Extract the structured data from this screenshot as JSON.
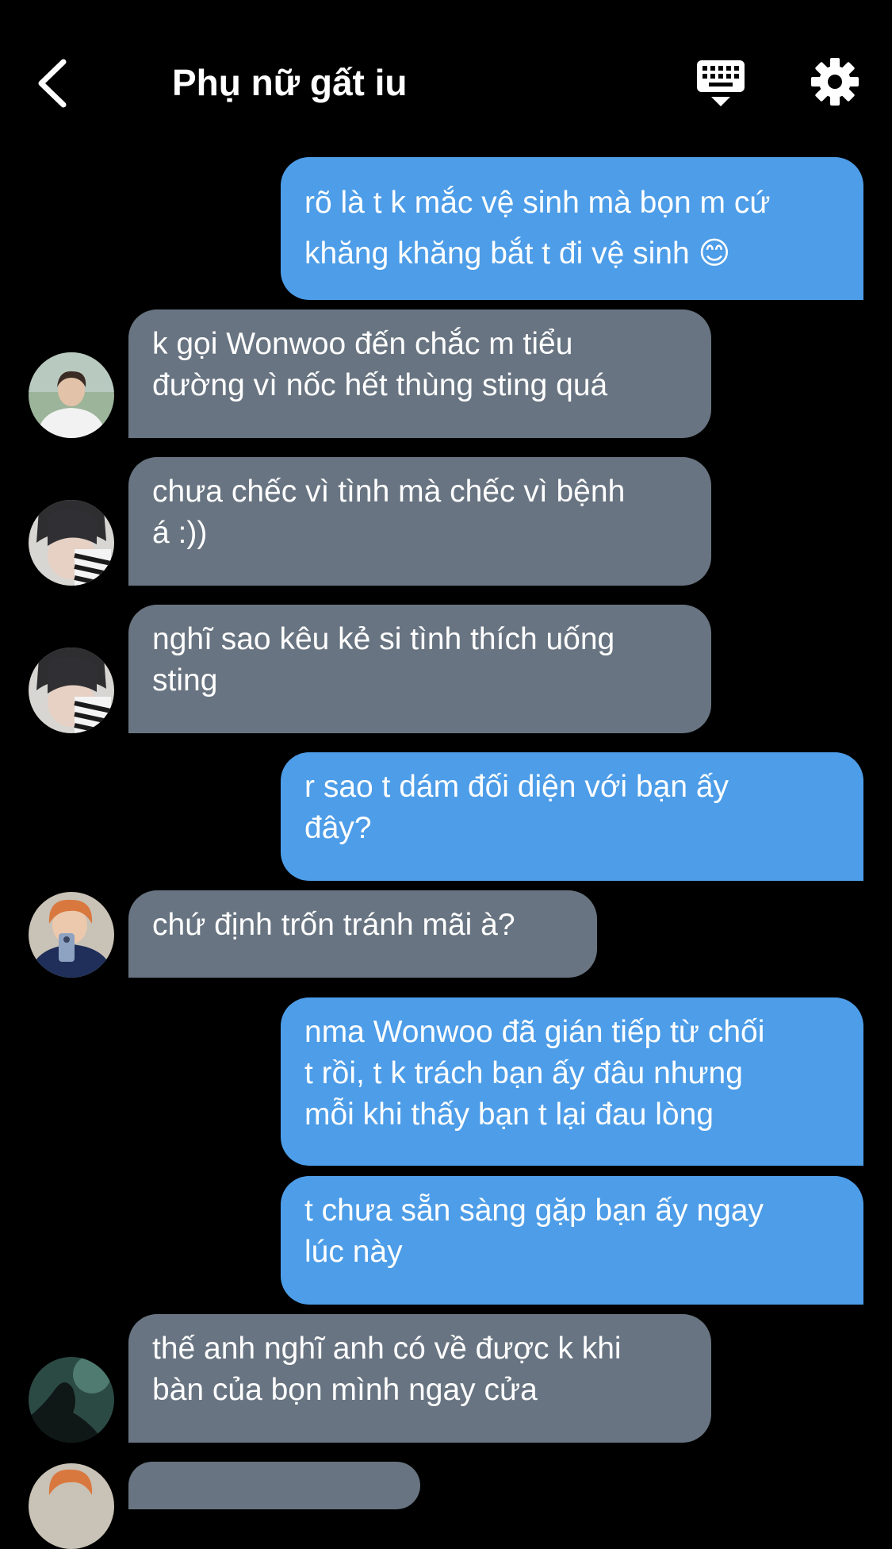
{
  "header": {
    "title": "Phụ nữ gất iu",
    "back_icon": "chevron-left-icon",
    "keyboard_icon": "keyboard-icon",
    "settings_icon": "gear-icon"
  },
  "colors": {
    "background": "#000000",
    "outgoing_bubble": "#4d9de8",
    "incoming_bubble": "#687481",
    "text": "#ffffff"
  },
  "messages": [
    {
      "direction": "out",
      "text": "rõ là t k mắc vệ sinh mà bọn m cứ\nkhăng khăng bắt t đi vệ sinh 😊"
    },
    {
      "direction": "in",
      "avatar": "avatar-boy-white-shirt",
      "text": "k gọi Wonwoo đến chắc m tiểu\nđường vì nốc hết thùng sting quá"
    },
    {
      "direction": "in",
      "avatar": "avatar-boy-striped-mask",
      "text": "chưa chếc vì tình mà chếc vì bệnh\ná :))"
    },
    {
      "direction": "in",
      "avatar": "avatar-boy-striped-mask",
      "text": "nghĩ sao kêu kẻ si tình thích uống\nsting"
    },
    {
      "direction": "out",
      "text": "r sao t dám đối diện với bạn ấy\nđây?"
    },
    {
      "direction": "in",
      "avatar": "avatar-orange-hair-phone",
      "text": "chứ định trốn tránh mãi à?"
    },
    {
      "direction": "out",
      "text": "nma Wonwoo đã gián tiếp từ chối\nt rồi, t k trách bạn ấy đâu nhưng\nmỗi khi thấy bạn t lại đau lòng"
    },
    {
      "direction": "out",
      "text": "t chưa sẵn sàng gặp bạn ấy ngay\nlúc này"
    },
    {
      "direction": "in",
      "avatar": "avatar-dark-teal-silhouette",
      "text": "thế anh nghĩ anh có về được k khi\nbàn của bọn mình ngay cửa"
    },
    {
      "direction": "in",
      "avatar": "avatar-orange-hair-partial",
      "text": ""
    }
  ]
}
